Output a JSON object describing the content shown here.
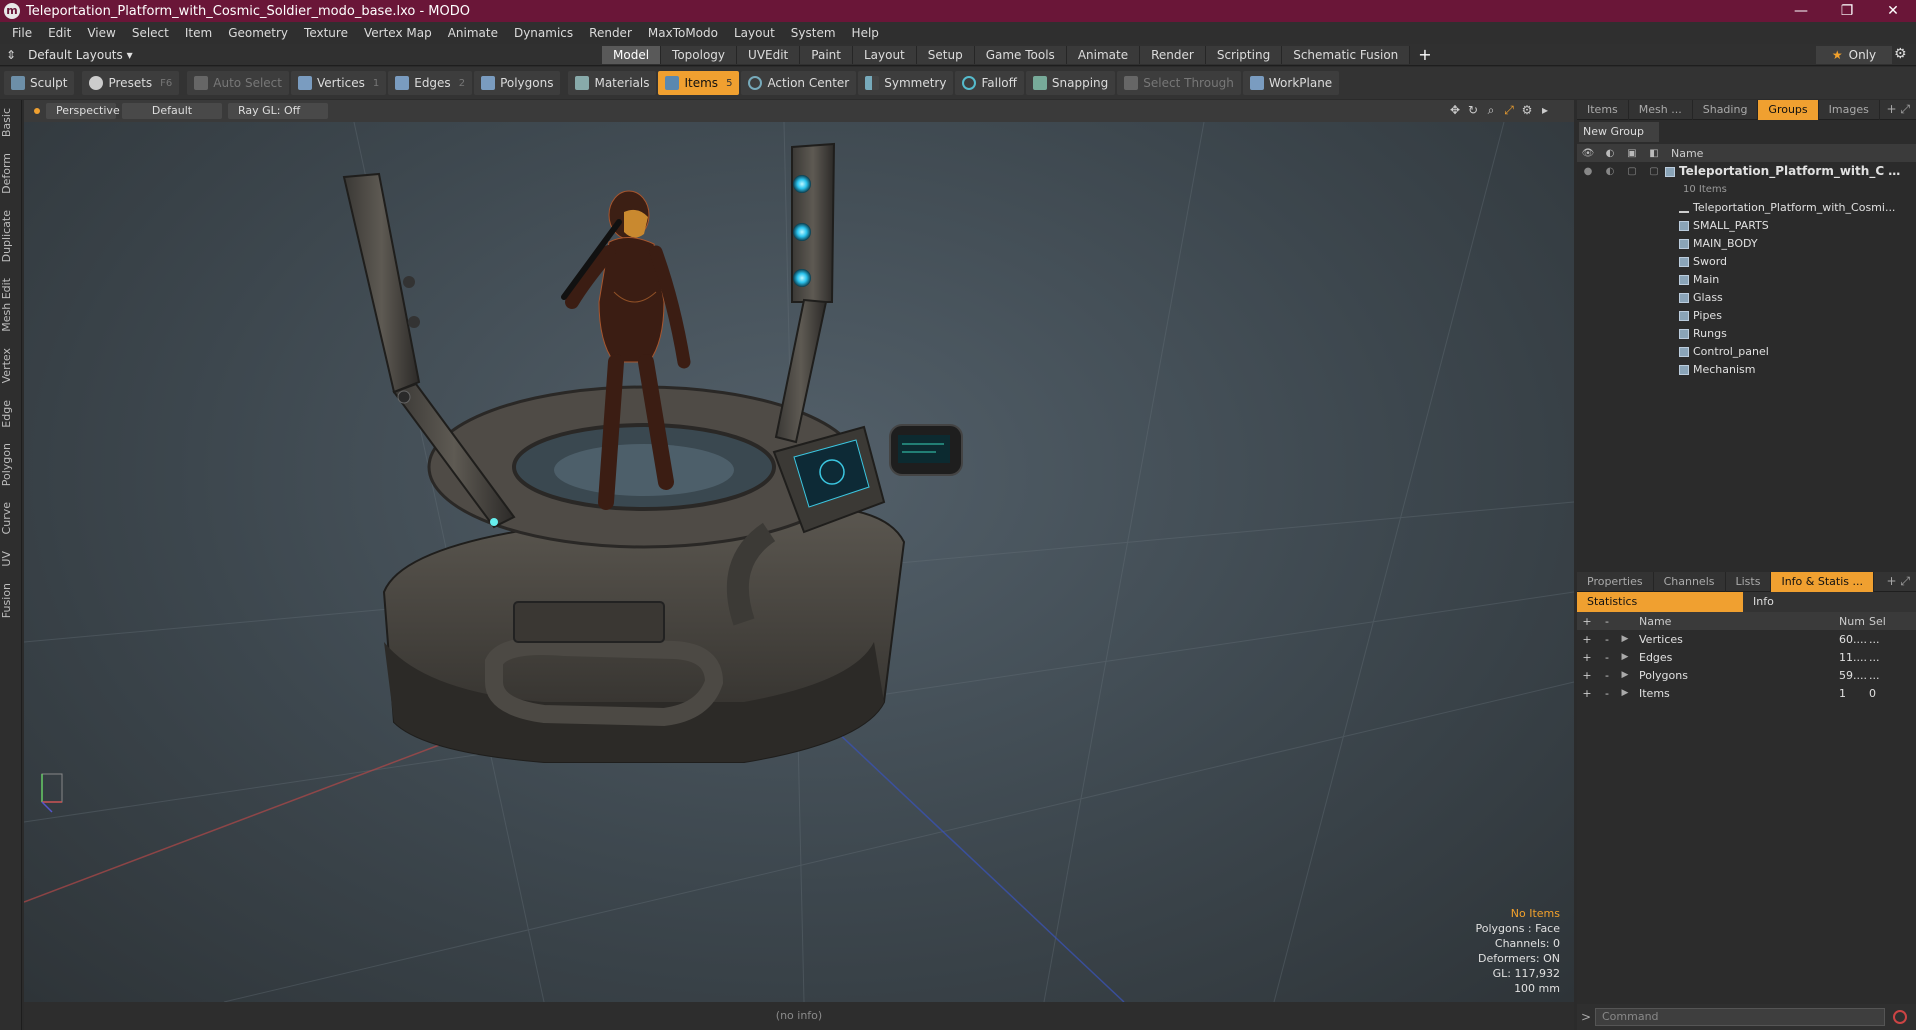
{
  "window": {
    "title": "Teleportation_Platform_with_Cosmic_Soldier_modo_base.lxo - MODO",
    "controls": [
      "—",
      "❐",
      "✕"
    ]
  },
  "menu": [
    "File",
    "Edit",
    "View",
    "Select",
    "Item",
    "Geometry",
    "Texture",
    "Vertex Map",
    "Animate",
    "Dynamics",
    "Render",
    "MaxToModo",
    "Layout",
    "System",
    "Help"
  ],
  "layoutbar": {
    "layouts_label": "Default Layouts ▾",
    "tabs": [
      "Model",
      "Topology",
      "UVEdit",
      "Paint",
      "Layout",
      "Setup",
      "Game Tools",
      "Animate",
      "Render",
      "Scripting",
      "Schematic Fusion"
    ],
    "active_tab": "Model",
    "only_label": "Only"
  },
  "toolbar": {
    "sculpt": "Sculpt",
    "presets": "Presets",
    "presets_key": "F6",
    "auto_select": "Auto Select",
    "vertices": "Vertices",
    "vertices_key": "1",
    "edges": "Edges",
    "edges_key": "2",
    "polygons": "Polygons",
    "materials": "Materials",
    "items": "Items",
    "items_key": "5",
    "action_center": "Action Center",
    "symmetry": "Symmetry",
    "falloff": "Falloff",
    "snapping": "Snapping",
    "select_through": "Select Through",
    "workplane": "WorkPlane"
  },
  "left_tabs": [
    "Basic",
    "Deform",
    "Duplicate",
    "Mesh Edit",
    "Vertex",
    "Edge",
    "Polygon",
    "Curve",
    "UV",
    "Fusion"
  ],
  "viewport": {
    "view_mode": "Perspective",
    "shading": "Default",
    "raygl": "Ray GL: Off",
    "info": {
      "no_items": "No Items",
      "polygons": "Polygons : Face",
      "channels": "Channels: 0",
      "deformers": "Deformers: ON",
      "gl": "GL: 117,932",
      "scale": "100 mm"
    },
    "status": "(no info)"
  },
  "groups_panel": {
    "tabs": [
      "Items",
      "Mesh ...",
      "Shading",
      "Groups",
      "Images"
    ],
    "active_tab": "Groups",
    "new_group": "New Group",
    "col_name": "Name",
    "root": "Teleportation_Platform_with_C ...",
    "root_count": "10 Items",
    "children": [
      "Teleportation_Platform_with_Cosmi...",
      "SMALL_PARTS",
      "MAIN_BODY",
      "Sword",
      "Main",
      "Glass",
      "Pipes",
      "Rungs",
      "Control_panel",
      "Mechanism"
    ]
  },
  "stats_panel": {
    "tabs": [
      "Properties",
      "Channels",
      "Lists",
      "Info & Statis ..."
    ],
    "active_tab": "Info & Statis ...",
    "sub_tabs": [
      "Statistics",
      "Info"
    ],
    "columns": {
      "name": "Name",
      "num": "Num",
      "sel": "Sel"
    },
    "rows": [
      {
        "name": "Vertices",
        "num": "60....",
        "sel": "..."
      },
      {
        "name": "Edges",
        "num": "11....",
        "sel": "..."
      },
      {
        "name": "Polygons",
        "num": "59....",
        "sel": "..."
      },
      {
        "name": "Items",
        "num": "1",
        "sel": "0"
      }
    ]
  },
  "command": {
    "placeholder": "Command"
  },
  "colors": {
    "accent": "#f0a030",
    "titlebar": "#6a1638"
  }
}
